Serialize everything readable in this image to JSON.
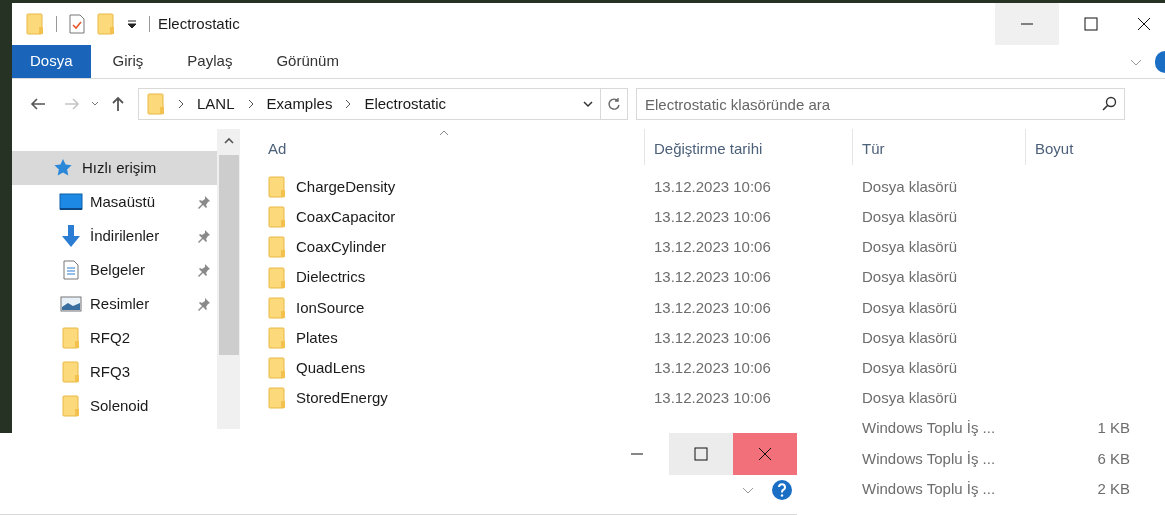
{
  "window": {
    "title": "Electrostatic"
  },
  "ribbon_tabs": [
    {
      "label": "Dosya",
      "selected": true
    },
    {
      "label": "Giriş",
      "selected": false
    },
    {
      "label": "Paylaş",
      "selected": false
    },
    {
      "label": "Görünüm",
      "selected": false
    }
  ],
  "address": {
    "path": [
      "LANL",
      "Examples",
      "Electrostatic"
    ]
  },
  "search": {
    "placeholder": "Electrostatic klasöründe ara"
  },
  "nav": [
    {
      "label": "Hızlı erişim",
      "kind": "quick",
      "selected": true,
      "pinned": false
    },
    {
      "label": "Masaüstü",
      "kind": "desktop",
      "selected": false,
      "pinned": true
    },
    {
      "label": "İndirilenler",
      "kind": "downloads",
      "selected": false,
      "pinned": true
    },
    {
      "label": "Belgeler",
      "kind": "documents",
      "selected": false,
      "pinned": true
    },
    {
      "label": "Resimler",
      "kind": "pictures",
      "selected": false,
      "pinned": true
    },
    {
      "label": "RFQ2",
      "kind": "folder",
      "selected": false,
      "pinned": false
    },
    {
      "label": "RFQ3",
      "kind": "folder",
      "selected": false,
      "pinned": false
    },
    {
      "label": "Solenoid",
      "kind": "folder",
      "selected": false,
      "pinned": false
    }
  ],
  "columns": [
    "Ad",
    "Değiştirme tarihi",
    "Tür",
    "Boyut"
  ],
  "files": [
    {
      "kind": "folder",
      "name": "ChargeDensity",
      "date": "13.12.2023 10:06",
      "type": "Dosya klasörü"
    },
    {
      "kind": "folder",
      "name": "CoaxCapacitor",
      "date": "13.12.2023 10:06",
      "type": "Dosya klasörü"
    },
    {
      "kind": "folder",
      "name": "CoaxCylinder",
      "date": "13.12.2023 10:06",
      "type": "Dosya klasörü"
    },
    {
      "kind": "folder",
      "name": "Dielectrics",
      "date": "13.12.2023 10:06",
      "type": "Dosya klasörü"
    },
    {
      "kind": "folder",
      "name": "IonSource",
      "date": "13.12.2023 10:06",
      "type": "Dosya klasörü"
    },
    {
      "kind": "folder",
      "name": "Plates",
      "date": "13.12.2023 10:06",
      "type": "Dosya klasörü"
    },
    {
      "kind": "folder",
      "name": "QuadLens",
      "date": "13.12.2023 10:06",
      "type": "Dosya klasörü"
    },
    {
      "kind": "folder",
      "name": "StoredEnergy",
      "date": "13.12.2023 10:06",
      "type": "Dosya klasörü"
    },
    {
      "kind": "hidden",
      "type": "Windows Toplu İş ...",
      "size": "1 KB"
    },
    {
      "kind": "hidden",
      "type": "Windows Toplu İş ...",
      "size": "6 KB"
    },
    {
      "kind": "hidden",
      "type": "Windows Toplu İş ...",
      "size": "2 KB"
    }
  ]
}
